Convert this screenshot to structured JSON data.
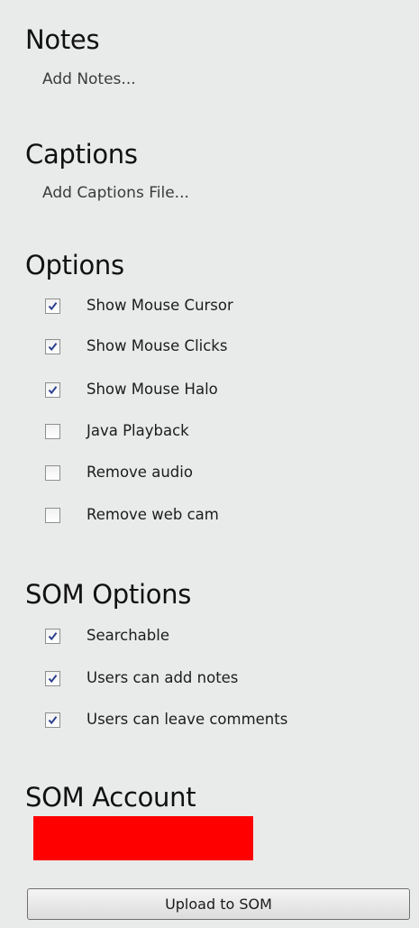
{
  "notes": {
    "title": "Notes",
    "add_label": "Add Notes..."
  },
  "captions": {
    "title": "Captions",
    "add_label": "Add Captions File..."
  },
  "options": {
    "title": "Options",
    "items": [
      {
        "label": "Show Mouse Cursor",
        "checked": true
      },
      {
        "label": "Show Mouse Clicks",
        "checked": true
      },
      {
        "label": "Show Mouse Halo",
        "checked": true
      },
      {
        "label": "Java Playback",
        "checked": false
      },
      {
        "label": "Remove audio",
        "checked": false
      },
      {
        "label": "Remove web cam",
        "checked": false
      }
    ]
  },
  "som_options": {
    "title": "SOM Options",
    "items": [
      {
        "label": "Searchable",
        "checked": true
      },
      {
        "label": "Users can add notes",
        "checked": true
      },
      {
        "label": "Users can leave comments",
        "checked": true
      }
    ]
  },
  "som_account": {
    "title": "SOM Account",
    "redaction_color": "#ff0000"
  },
  "upload_button": {
    "label": "Upload to SOM"
  },
  "colors": {
    "background": "#e9eaea",
    "checkmark": "#2a3f8f",
    "redaction": "#ff0000"
  }
}
